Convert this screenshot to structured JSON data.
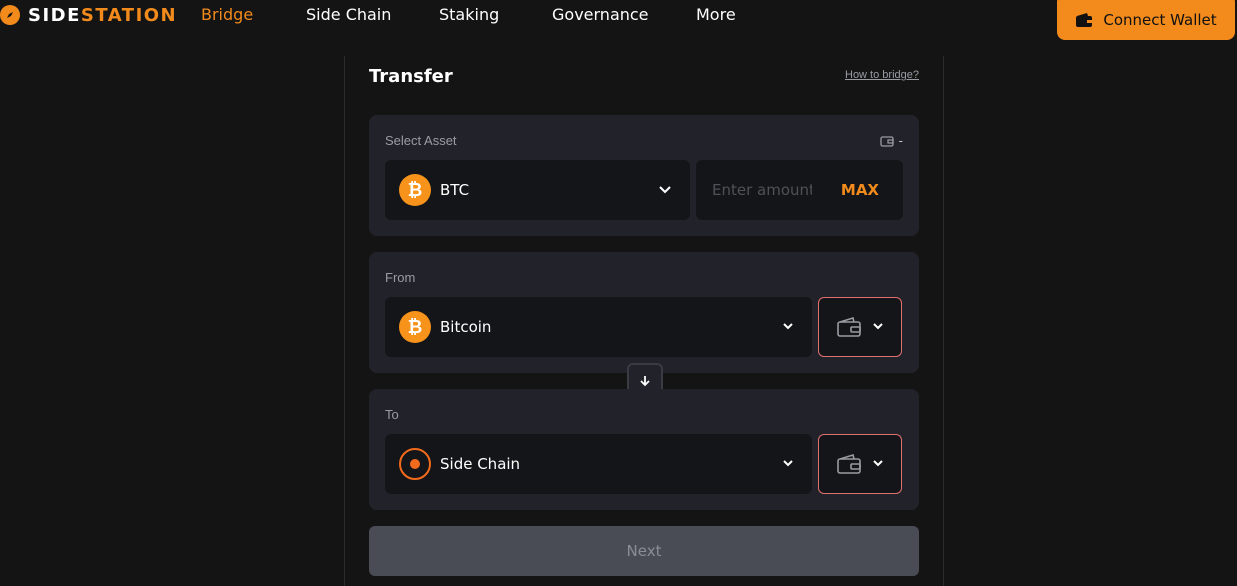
{
  "brand": {
    "part1": "SIDE",
    "part2": "STATION"
  },
  "nav": {
    "items": [
      {
        "label": "Bridge",
        "active": true
      },
      {
        "label": "Side Chain",
        "active": false
      },
      {
        "label": "Staking",
        "active": false
      },
      {
        "label": "Governance",
        "active": false
      },
      {
        "label": "More",
        "active": false
      }
    ],
    "connect_label": "Connect Wallet"
  },
  "transfer": {
    "title": "Transfer",
    "help_link": "How to bridge?",
    "asset": {
      "label": "Select Asset",
      "balance": "-",
      "selected": "BTC",
      "amount_placeholder": "Enter amount",
      "max_label": "MAX"
    },
    "from": {
      "label": "From",
      "chain": "Bitcoin"
    },
    "to": {
      "label": "To",
      "chain": "Side Chain"
    },
    "next_label": "Next"
  },
  "colors": {
    "accent": "#f28a1c",
    "background": "#141414",
    "card": "#22232a",
    "wallet_border": "#e07070"
  },
  "icons": {
    "logo": "compass-icon",
    "connect": "wallet-icon",
    "asset_dropdown": "chevron-down-icon",
    "balance": "wallet-icon",
    "swap": "arrow-down-icon"
  }
}
